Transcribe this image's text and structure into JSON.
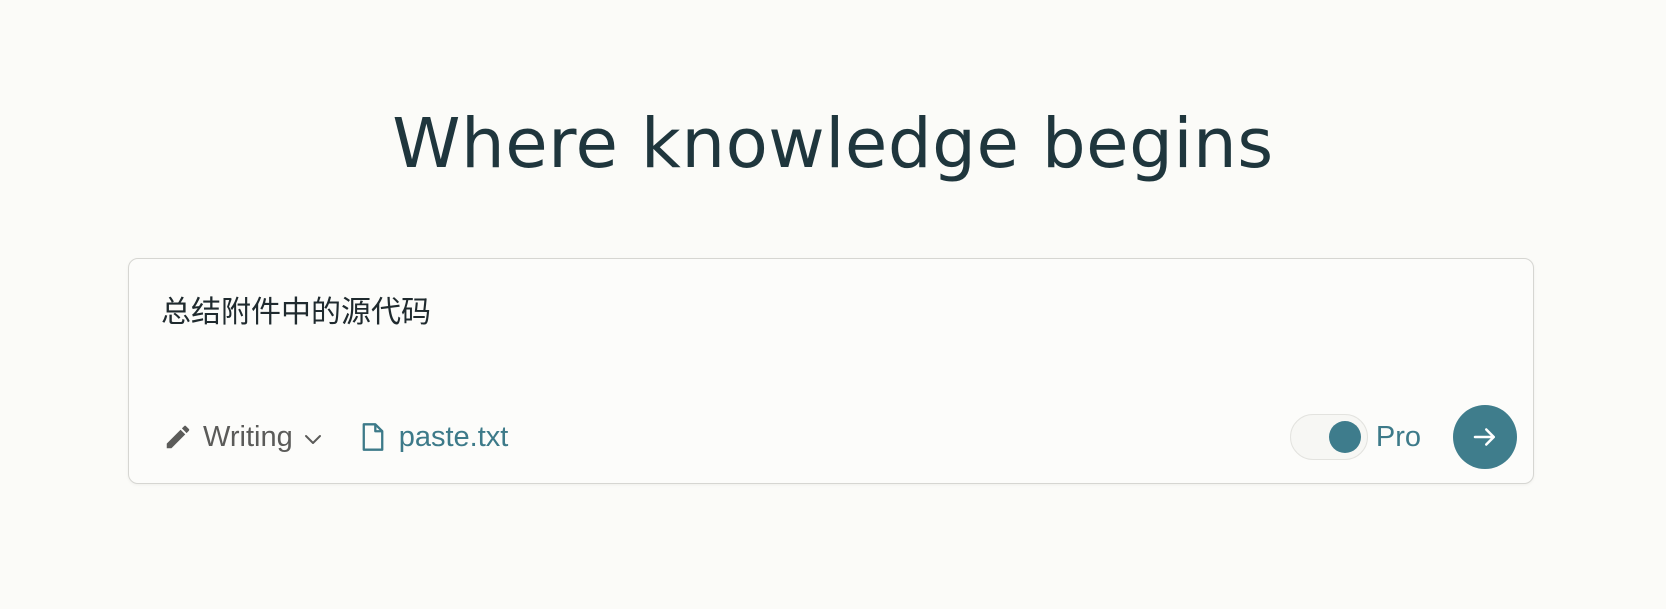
{
  "headline": "Where knowledge begins",
  "search": {
    "query": "总结附件中的源代码"
  },
  "toolbar": {
    "focus": {
      "icon": "pencil-icon",
      "label": "Writing",
      "chevron": "chevron-down-icon"
    },
    "attachment": {
      "icon": "file-icon",
      "filename": "paste.txt"
    },
    "pro_toggle": {
      "label": "Pro",
      "enabled": true
    },
    "submit": {
      "icon": "arrow-right-icon"
    }
  },
  "colors": {
    "background": "#fbfbf8",
    "accent": "#3f7d8c",
    "heading": "#1f363d",
    "muted": "#5b5b59"
  }
}
